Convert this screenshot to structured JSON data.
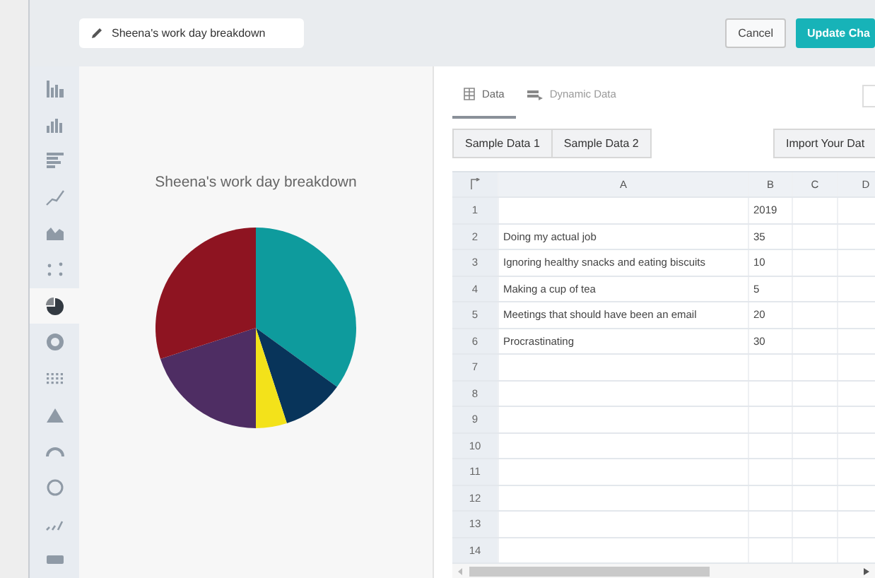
{
  "header": {
    "title_field": "Sheena's work day breakdown",
    "buttons": [
      {
        "label": "Cancel",
        "kind": "secondary"
      },
      {
        "label": "Update Cha",
        "kind": "primary"
      }
    ]
  },
  "sidebar": {
    "items": [
      {
        "kind": "column",
        "selected": false
      },
      {
        "kind": "histogram",
        "selected": false
      },
      {
        "kind": "bar",
        "selected": false
      },
      {
        "kind": "line",
        "selected": false
      },
      {
        "kind": "area",
        "selected": false
      },
      {
        "kind": "scatter",
        "selected": false
      },
      {
        "kind": "pie",
        "selected": true
      },
      {
        "kind": "donut",
        "selected": false
      },
      {
        "kind": "grid",
        "selected": false
      },
      {
        "kind": "pyramid",
        "selected": false
      },
      {
        "kind": "gauge",
        "selected": false
      },
      {
        "kind": "ring",
        "selected": false
      },
      {
        "kind": "sparkline",
        "selected": false
      },
      {
        "kind": "number",
        "selected": false
      }
    ]
  },
  "chart": {
    "chart_data": {
      "type": "pie",
      "title": "Sheena's work day breakdown",
      "values": [
        35,
        10,
        5,
        20,
        30
      ],
      "colors": [
        "#0e9b9d",
        "#08345a",
        "#f3e21a",
        "#4e2d63",
        "#8e1421"
      ]
    }
  },
  "tabs": [
    {
      "label": "Data",
      "kind": "table",
      "selected": true
    },
    {
      "label": "Dynamic Data",
      "kind": "dynamic",
      "selected": false
    }
  ],
  "sample_buttons": [
    "Sample Data 1",
    "Sample Data 2"
  ],
  "import_button": "Import Your Dat",
  "table": {
    "columns": [
      "A",
      "B",
      "C",
      "D"
    ],
    "rows": [
      {
        "number": "1",
        "cells": [
          "",
          "2019",
          "",
          ""
        ]
      },
      {
        "number": "2",
        "cells": [
          "Doing my actual job",
          "35",
          "",
          ""
        ]
      },
      {
        "number": "3",
        "cells": [
          "Ignoring healthy snacks and eating biscuits",
          "10",
          "",
          ""
        ]
      },
      {
        "number": "4",
        "cells": [
          "Making a cup of tea",
          "5",
          "",
          ""
        ]
      },
      {
        "number": "5",
        "cells": [
          "Meetings that should have been an email",
          "20",
          "",
          ""
        ]
      },
      {
        "number": "6",
        "cells": [
          "Procrastinating",
          "30",
          "",
          ""
        ]
      },
      {
        "number": "7",
        "cells": [
          "",
          "",
          "",
          ""
        ]
      },
      {
        "number": "8",
        "cells": [
          "",
          "",
          "",
          ""
        ]
      },
      {
        "number": "9",
        "cells": [
          "",
          "",
          "",
          ""
        ]
      },
      {
        "number": "10",
        "cells": [
          "",
          "",
          "",
          ""
        ]
      },
      {
        "number": "11",
        "cells": [
          "",
          "",
          "",
          ""
        ]
      },
      {
        "number": "12",
        "cells": [
          "",
          "",
          "",
          ""
        ]
      },
      {
        "number": "13",
        "cells": [
          "",
          "",
          "",
          ""
        ]
      },
      {
        "number": "14",
        "cells": [
          "",
          "",
          "",
          ""
        ]
      }
    ]
  }
}
